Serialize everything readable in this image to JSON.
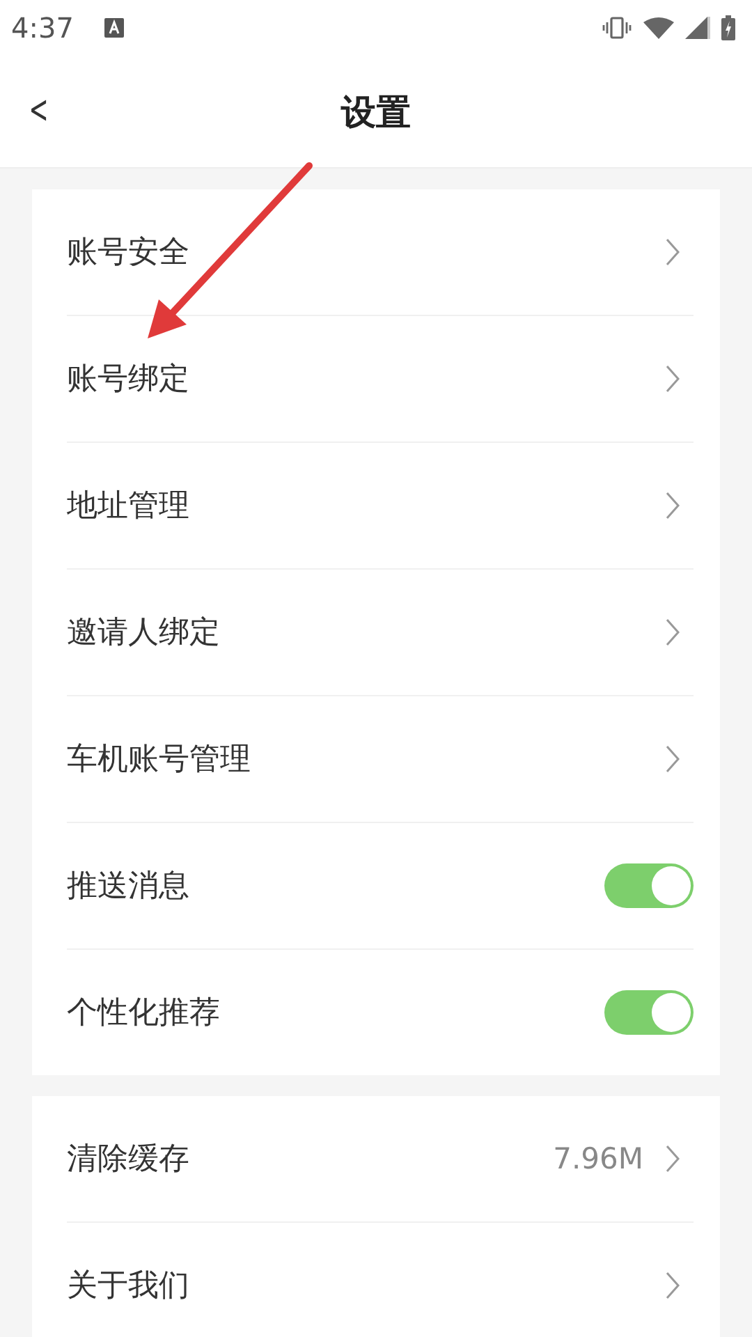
{
  "status_bar": {
    "time": "4:37"
  },
  "header": {
    "back": "<",
    "title": "设置"
  },
  "groups": [
    {
      "items": [
        {
          "kind": "link",
          "label": "账号安全"
        },
        {
          "kind": "link",
          "label": "账号绑定"
        },
        {
          "kind": "link",
          "label": "地址管理"
        },
        {
          "kind": "link",
          "label": "邀请人绑定"
        },
        {
          "kind": "link",
          "label": "车机账号管理"
        },
        {
          "kind": "toggle",
          "label": "推送消息",
          "on": true
        },
        {
          "kind": "toggle",
          "label": "个性化推荐",
          "on": true
        }
      ]
    },
    {
      "items": [
        {
          "kind": "link",
          "label": "清除缓存",
          "value": "7.96M"
        },
        {
          "kind": "link",
          "label": "关于我们"
        }
      ]
    }
  ]
}
